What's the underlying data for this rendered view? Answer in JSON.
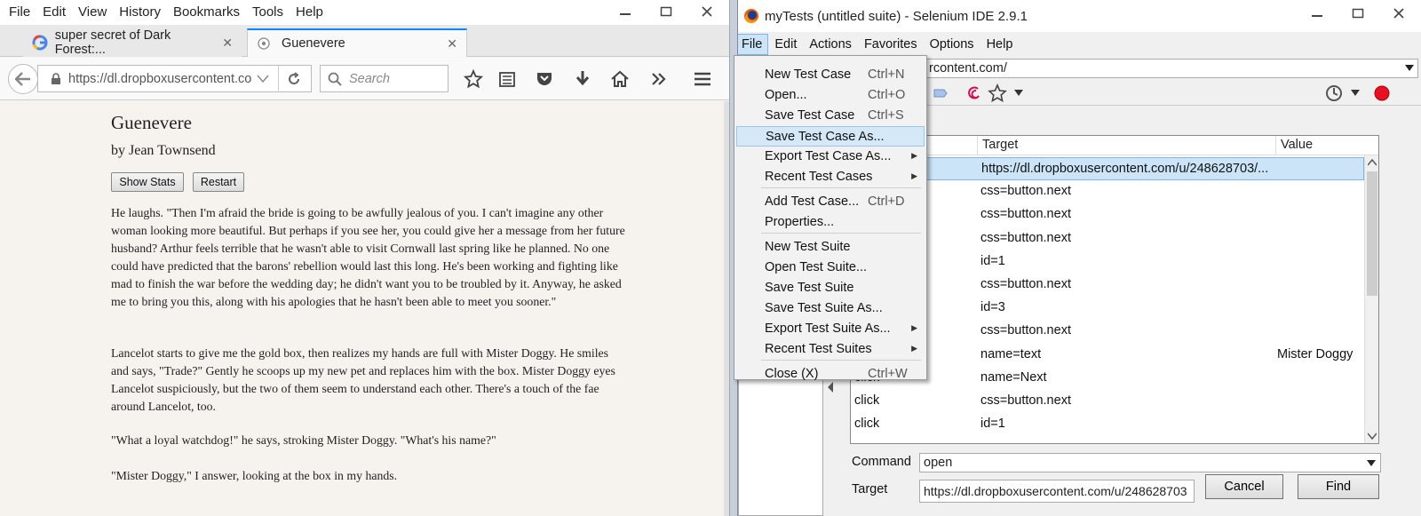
{
  "firefox": {
    "menus": [
      "File",
      "Edit",
      "View",
      "History",
      "Bookmarks",
      "Tools",
      "Help"
    ],
    "tabs": [
      {
        "title": "super secret of Dark Forest:...",
        "icon": "google-icon"
      },
      {
        "title": "Guenevere",
        "icon": "globe-icon"
      }
    ],
    "url": "https://dl.dropboxusercontent.co",
    "search_placeholder": "Search"
  },
  "story": {
    "title": "Guenevere",
    "author": "by Jean Townsend",
    "buttons": {
      "stats": "Show Stats",
      "restart": "Restart"
    },
    "paragraphs": [
      "He laughs. \"Then I'm afraid the bride is going to be awfully jealous of you. I can't imagine any other woman looking more beautiful. But perhaps if you see her, you could give her a message from her future husband? Arthur feels terrible that he wasn't able to visit Cornwall last spring like he planned. No one could have predicted that the barons' rebellion would last this long. He's been working and fighting like mad to finish the war before the wedding day; he didn't want you to be troubled by it. Anyway, he asked me to bring you this, along with his apologies that he hasn't been able to meet you sooner.\"",
      "Lancelot starts to give me the gold box, then realizes my hands are full with Mister Doggy. He smiles and says, \"Trade?\" Gently he scoops up my new pet and replaces him with the box. Mister Doggy eyes Lancelot suspiciously, but the two of them seem to understand each other. There's a touch of the fae around Lancelot, too.",
      "\"What a loyal watchdog!\" he says, stroking Mister Doggy. \"What's his name?\"",
      "\"Mister Doggy,\" I answer, looking at the box in my hands."
    ]
  },
  "selenium": {
    "title": "myTests (untitled suite) - Selenium IDE 2.9.1",
    "menus": [
      "File",
      "Edit",
      "Actions",
      "Favorites",
      "Options",
      "Help"
    ],
    "base_url": "rcontent.com/",
    "grid": {
      "headers": {
        "target": "Target",
        "value": "Value"
      },
      "rows": [
        {
          "command": "",
          "target": "https://dl.dropboxusercontent.com/u/248628703/...",
          "value": ""
        },
        {
          "command": "",
          "target": "css=button.next",
          "value": ""
        },
        {
          "command": "",
          "target": "css=button.next",
          "value": ""
        },
        {
          "command": "",
          "target": "css=button.next",
          "value": ""
        },
        {
          "command": "",
          "target": "id=1",
          "value": ""
        },
        {
          "command": "",
          "target": "css=button.next",
          "value": ""
        },
        {
          "command": "",
          "target": "id=3",
          "value": ""
        },
        {
          "command": "",
          "target": "css=button.next",
          "value": ""
        },
        {
          "command": "",
          "target": "name=text",
          "value": "Mister Doggy"
        },
        {
          "command": "click",
          "target": "name=Next",
          "value": ""
        },
        {
          "command": "click",
          "target": "css=button.next",
          "value": ""
        },
        {
          "command": "click",
          "target": "id=1",
          "value": ""
        }
      ]
    },
    "command_label": "Command",
    "command_value": "open",
    "target_label": "Target",
    "target_value": "https://dl.dropboxusercontent.com/u/248628703",
    "cancel_label": "Cancel",
    "find_label": "Find"
  },
  "file_menu": {
    "items": [
      {
        "label": "New Test Case",
        "shortcut": "Ctrl+N"
      },
      {
        "label": "Open...",
        "shortcut": "Ctrl+O"
      },
      {
        "label": "Save Test Case",
        "shortcut": "Ctrl+S"
      },
      {
        "label": "Save Test Case As...",
        "shortcut": ""
      },
      {
        "label": "Export Test Case As...",
        "shortcut": ""
      },
      {
        "label": "Recent Test Cases",
        "shortcut": ""
      },
      {
        "label": "Add Test Case...",
        "shortcut": "Ctrl+D"
      },
      {
        "label": "Properties...",
        "shortcut": ""
      },
      {
        "label": "New Test Suite",
        "shortcut": ""
      },
      {
        "label": "Open Test Suite...",
        "shortcut": ""
      },
      {
        "label": "Save Test Suite",
        "shortcut": ""
      },
      {
        "label": "Save Test Suite As...",
        "shortcut": ""
      },
      {
        "label": "Export Test Suite As...",
        "shortcut": ""
      },
      {
        "label": "Recent Test Suites",
        "shortcut": ""
      },
      {
        "label": "Close (X)",
        "shortcut": "Ctrl+W"
      }
    ]
  },
  "colors": {
    "accent": "#0a84ff",
    "selection": "#cce4f7",
    "record": "#e81123"
  }
}
